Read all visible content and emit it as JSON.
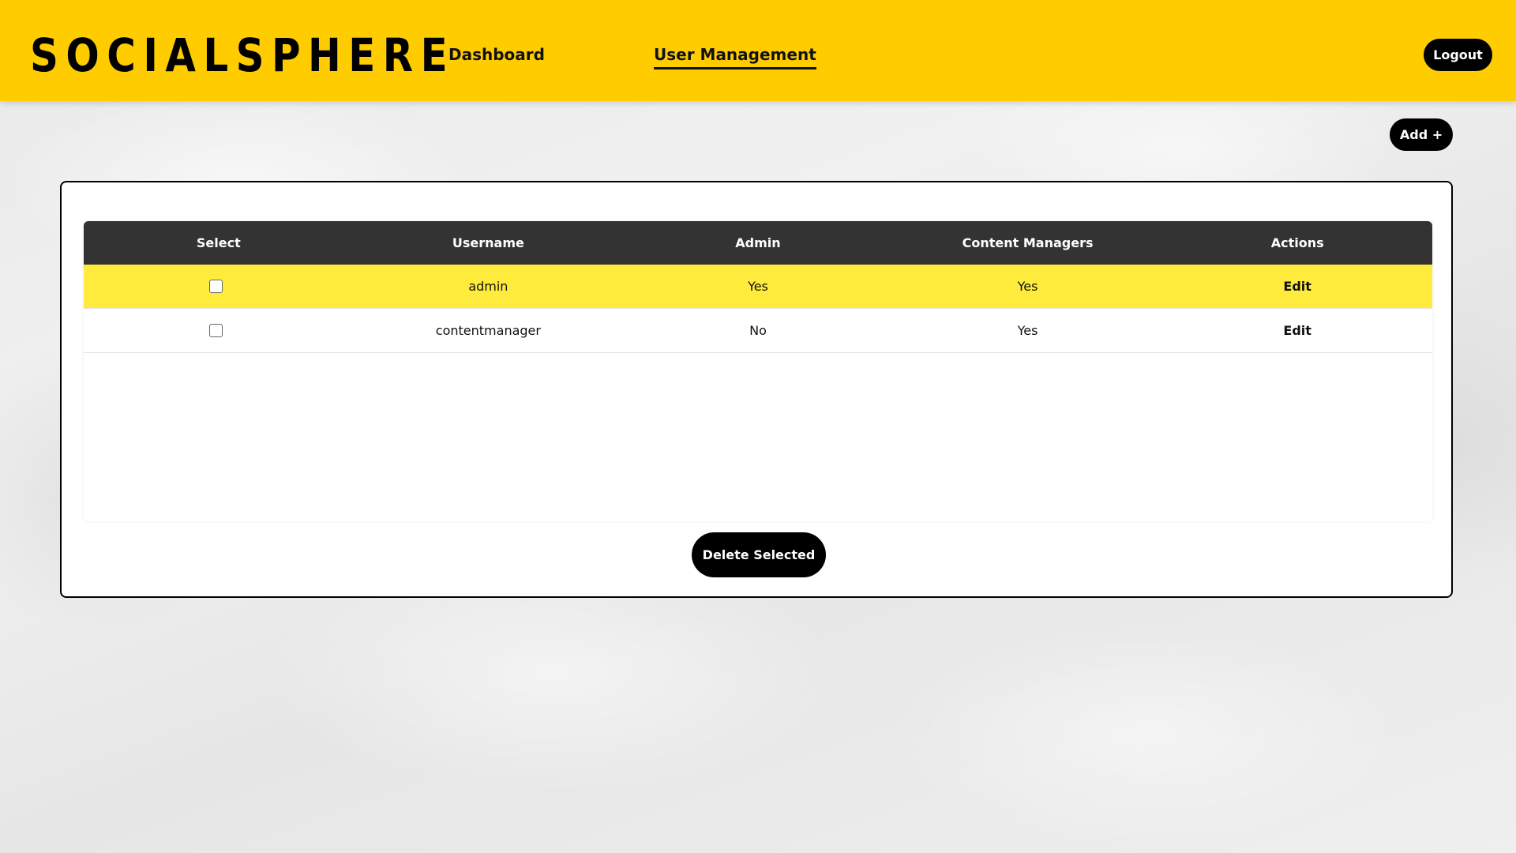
{
  "header": {
    "logo": "SOCIALSPHERE",
    "nav": [
      {
        "label": "Dashboard",
        "active": false
      },
      {
        "label": "User Management",
        "active": true
      }
    ],
    "logout_label": "Logout"
  },
  "toolbar": {
    "add_label": "Add +"
  },
  "table": {
    "columns": [
      "Select",
      "Username",
      "Admin",
      "Content Managers",
      "Actions"
    ],
    "rows": [
      {
        "selected": false,
        "username": "admin",
        "admin": "Yes",
        "content_managers": "Yes",
        "action": "Edit",
        "highlighted": true
      },
      {
        "selected": false,
        "username": "contentmanager",
        "admin": "No",
        "content_managers": "Yes",
        "action": "Edit",
        "highlighted": false
      }
    ]
  },
  "footer": {
    "delete_label": "Delete Selected"
  },
  "colors": {
    "brand_yellow": "#ffcc00",
    "row_highlight": "#ffeb3b",
    "header_dark": "#333333",
    "button_black": "#000000"
  }
}
